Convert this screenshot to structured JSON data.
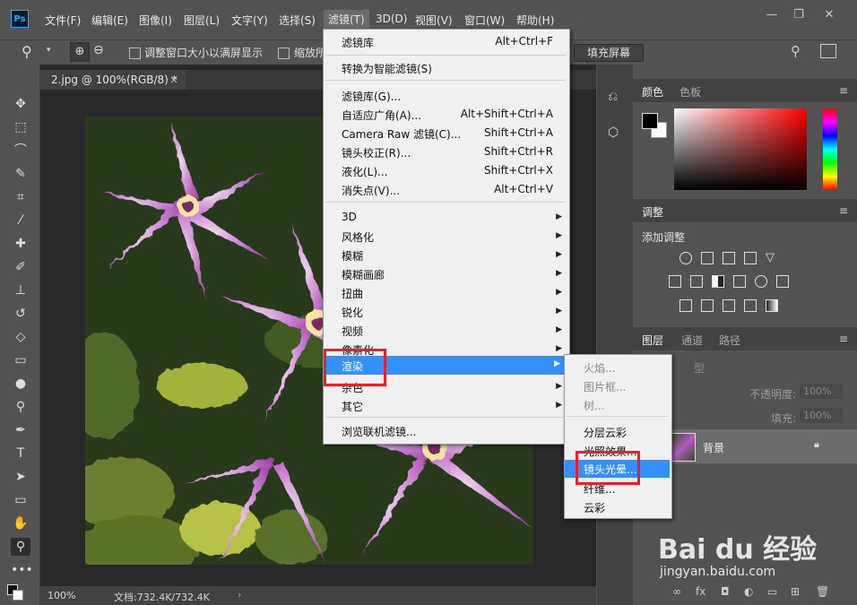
{
  "app": {
    "logo": "Ps"
  },
  "menubar": {
    "items": [
      "文件(F)",
      "编辑(E)",
      "图像(I)",
      "图层(L)",
      "文字(Y)",
      "选择(S)",
      "滤镜(T)",
      "3D(D)",
      "视图(V)",
      "窗口(W)",
      "帮助(H)"
    ],
    "active_index": 6
  },
  "window_controls": {
    "minimize": "—",
    "restore": "❐",
    "close": "✕"
  },
  "options": {
    "fit_window_label": "调整窗口大小以满屏显示",
    "zoom_all_label": "缩放所",
    "fill_screen_button": "填充屏幕"
  },
  "document": {
    "tab_title": "2.jpg @ 100%(RGB/8) *",
    "tab_close": "×",
    "zoom": "100%",
    "doc_info": "文档:732.4K/732.4K"
  },
  "filter_menu": {
    "items": [
      {
        "label": "滤镜库",
        "shortcut": "Alt+Ctrl+F"
      },
      {
        "label": "转换为智能滤镜(S)",
        "shortcut": ""
      },
      {
        "label": "滤镜库(G)...",
        "shortcut": ""
      },
      {
        "label": "自适应广角(A)...",
        "shortcut": "Alt+Shift+Ctrl+A"
      },
      {
        "label": "Camera Raw 滤镜(C)...",
        "shortcut": "Shift+Ctrl+A"
      },
      {
        "label": "镜头校正(R)...",
        "shortcut": "Shift+Ctrl+R"
      },
      {
        "label": "液化(L)...",
        "shortcut": "Shift+Ctrl+X"
      },
      {
        "label": "消失点(V)...",
        "shortcut": "Alt+Ctrl+V"
      },
      {
        "label": "3D",
        "shortcut": ""
      },
      {
        "label": "风格化",
        "shortcut": ""
      },
      {
        "label": "模糊",
        "shortcut": ""
      },
      {
        "label": "模糊画廊",
        "shortcut": ""
      },
      {
        "label": "扭曲",
        "shortcut": ""
      },
      {
        "label": "锐化",
        "shortcut": ""
      },
      {
        "label": "视频",
        "shortcut": ""
      },
      {
        "label": "像素化",
        "shortcut": ""
      },
      {
        "label": "渲染",
        "shortcut": ""
      },
      {
        "label": "杂色",
        "shortcut": ""
      },
      {
        "label": "其它",
        "shortcut": ""
      },
      {
        "label": "浏览联机滤镜...",
        "shortcut": ""
      }
    ]
  },
  "render_submenu": {
    "items": [
      {
        "label": "火焰...",
        "disabled": true
      },
      {
        "label": "图片框...",
        "disabled": true
      },
      {
        "label": "树...",
        "disabled": true
      },
      {
        "label": "分层云彩",
        "disabled": false
      },
      {
        "label": "光照效果...",
        "disabled": false
      },
      {
        "label": "镜头光晕...",
        "disabled": false
      },
      {
        "label": "纤维...",
        "disabled": false
      },
      {
        "label": "云彩",
        "disabled": false
      }
    ],
    "highlighted_index": 5
  },
  "panels": {
    "color_tabs": [
      "颜色",
      "色板"
    ],
    "adjust_tab": "调整",
    "add_adjustment": "添加调整",
    "layers_tabs": [
      "图层",
      "通道",
      "路径"
    ],
    "kind_label": "型",
    "opacity_label": "不透明度:",
    "opacity_value": "100%",
    "fill_label": "填充:",
    "fill_value": "100%",
    "layer_name": "背景"
  },
  "watermark": {
    "brand": "Bai du 经验",
    "url": "jingyan.baidu.com"
  },
  "colors": {
    "highlight": "#3390ff",
    "annotation": "#e8202a",
    "menu_bg": "#f0f0f0"
  }
}
